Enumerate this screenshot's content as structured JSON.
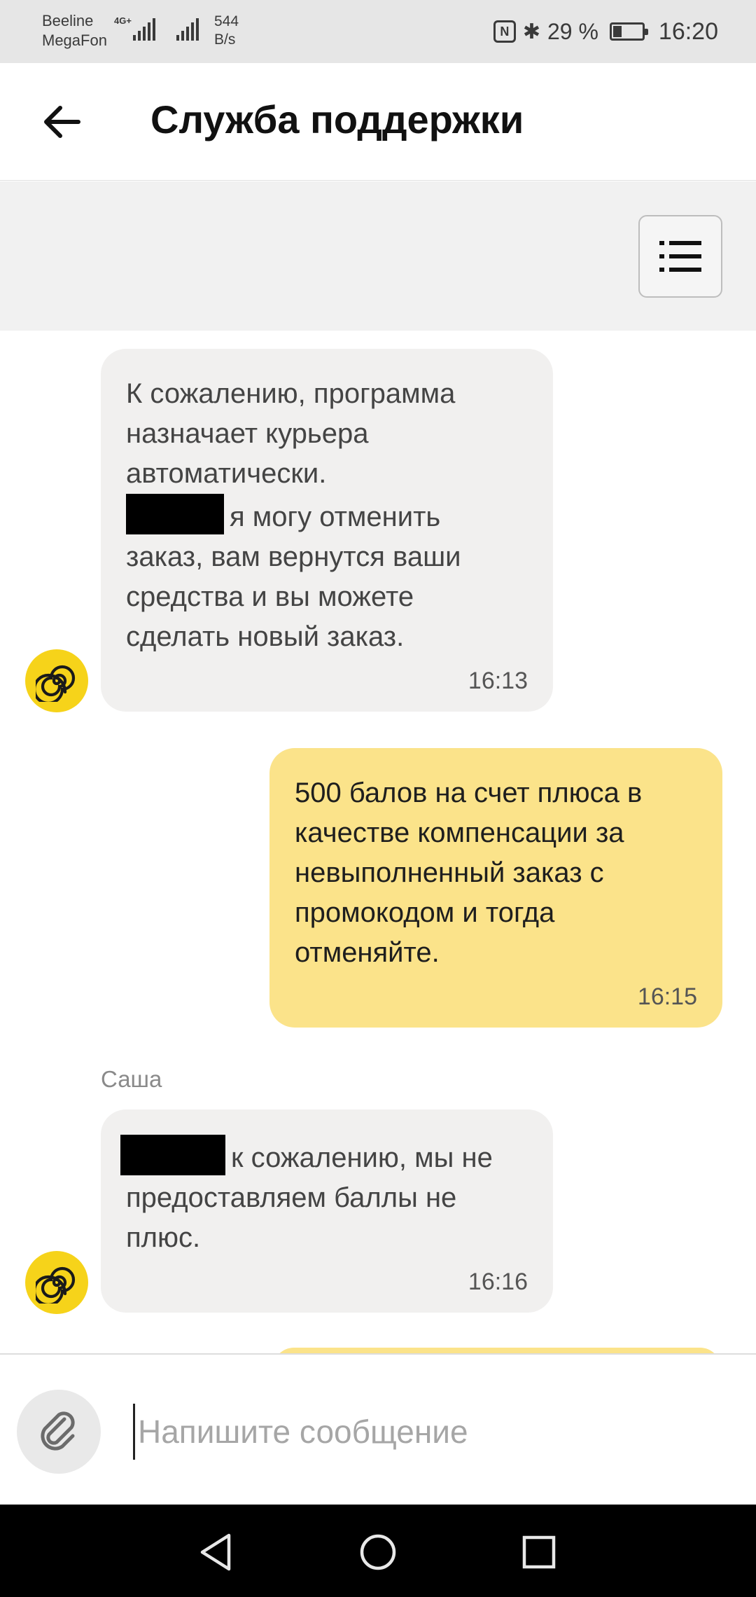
{
  "status_bar": {
    "carrier_1": "Beeline",
    "carrier_2": "MegaFon",
    "network": "4G+",
    "speed_value": "544",
    "speed_unit": "B/s",
    "nfc_label": "N",
    "bluetooth_glyph": "✱",
    "battery": "29 %",
    "time": "16:20"
  },
  "header": {
    "title": "Служба поддержки",
    "back_icon": "arrow-left-icon"
  },
  "toolbar": {
    "menu_icon": "list-icon"
  },
  "chat": {
    "messages": [
      {
        "direction": "incoming",
        "text_before": "К сожалению, программа\nназначает курьера\nавтоматически.",
        "text_after": "я могу отменить\nзаказ, вам вернутся ваши\nсредства и вы можете\nсделать новый заказ.",
        "time": "16:13"
      },
      {
        "direction": "outgoing",
        "text": "500 балов на счет плюса в\nкачестве компенсации за\nневыполненный заказ с\nпромокодом и тогда\nотменяйте.",
        "time": "16:15"
      },
      {
        "direction": "incoming",
        "sender": "Саша",
        "text_after": "к сожалению, мы не\nпредоставляем баллы не\nплюс.",
        "time": "16:16"
      }
    ]
  },
  "input": {
    "placeholder": "Напишите сообщение",
    "value": "",
    "attach_icon": "paperclip-icon"
  },
  "colors": {
    "incoming_bubble": "#f1f0ef",
    "outgoing_bubble": "#fbe38a",
    "avatar": "#f6d31a",
    "menu_band": "#f1f1f1"
  }
}
